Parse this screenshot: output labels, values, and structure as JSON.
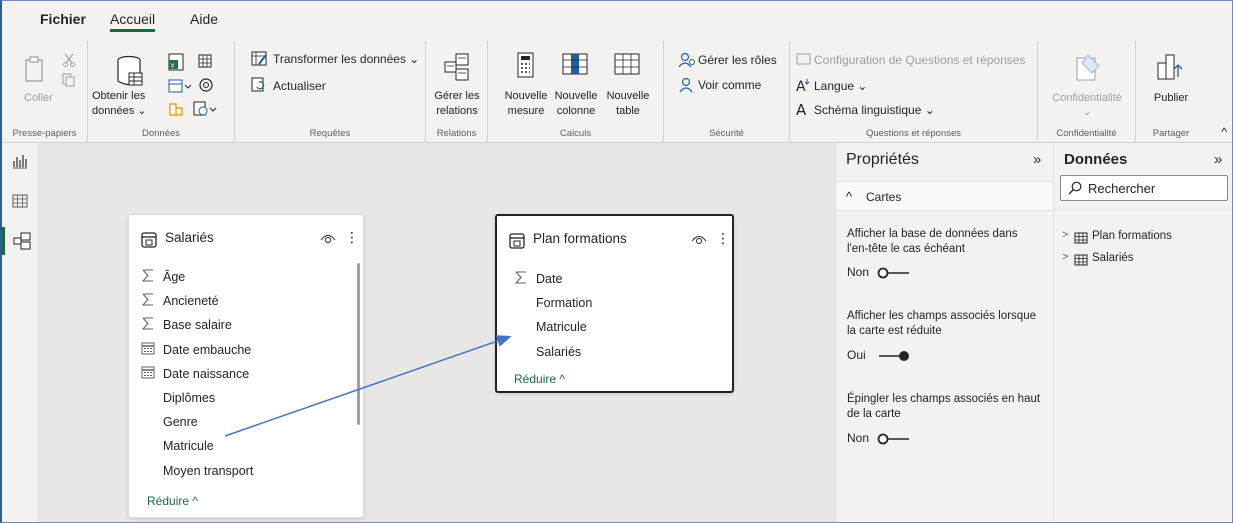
{
  "menu": {
    "tabs": [
      "Fichier",
      "Accueil",
      "Aide"
    ]
  },
  "ribbon": {
    "presse_papiers": {
      "label": "Presse-papiers",
      "coller": "Coller"
    },
    "donnees": {
      "label": "Données",
      "obtenir_line1": "Obtenir les",
      "obtenir_line2": "données ⌄"
    },
    "requetes": {
      "label": "Requêtes",
      "transformer": "Transformer les données ⌄",
      "actualiser": "Actualiser"
    },
    "relations": {
      "label": "Relations",
      "gerer_line1": "Gérer les",
      "gerer_line2": "relations"
    },
    "calculs": {
      "label": "Calculs",
      "mesure_line1": "Nouvelle",
      "mesure_line2": "mesure",
      "colonne_line1": "Nouvelle",
      "colonne_line2": "colonne",
      "table_line1": "Nouvelle",
      "table_line2": "table"
    },
    "securite": {
      "label": "Sécurité",
      "gerer_roles": "Gérer les rôles",
      "voir_comme": "Voir comme"
    },
    "questions": {
      "label": "Questions et réponses",
      "config": "Configuration de Questions et réponses",
      "langue": "Langue ⌄",
      "schema": "Schéma linguistique ⌄"
    },
    "confidentialite": {
      "label": "Confidentialité",
      "button": "Confidentialité",
      "caret": "⌄"
    },
    "partager": {
      "label": "Partager",
      "publier": "Publier"
    },
    "collapse": "^"
  },
  "tables": [
    {
      "title": "Salariés",
      "fields": [
        {
          "name": "Âge",
          "icon": "sigma"
        },
        {
          "name": "Ancieneté",
          "icon": "sigma"
        },
        {
          "name": "Base salaire",
          "icon": "sigma"
        },
        {
          "name": "Date embauche",
          "icon": "calendar"
        },
        {
          "name": "Date naissance",
          "icon": "calendar"
        },
        {
          "name": "Diplômes",
          "icon": ""
        },
        {
          "name": "Genre",
          "icon": ""
        },
        {
          "name": "Matricule",
          "icon": ""
        },
        {
          "name": "Moyen transport",
          "icon": ""
        }
      ],
      "reduce": "Réduire ^"
    },
    {
      "title": "Plan formations",
      "fields": [
        {
          "name": "Date",
          "icon": "sigma"
        },
        {
          "name": "Formation",
          "icon": ""
        },
        {
          "name": "Matricule",
          "icon": ""
        },
        {
          "name": "Salariés",
          "icon": ""
        }
      ],
      "reduce": "Réduire ^"
    }
  ],
  "properties": {
    "title": "Propriétés",
    "expand_icon": "»",
    "section": "Cartes",
    "section_caret": "^",
    "opt1_line1": "Afficher la base de données dans",
    "opt1_line2": "l'en-tête le cas échéant",
    "opt1_value": "Non",
    "opt2_line1": "Afficher les champs associés lorsque",
    "opt2_line2": "la carte est réduite",
    "opt2_value": "Oui",
    "opt3_line1": "Épingler les champs associés en haut",
    "opt3_line2": "de la carte",
    "opt3_value": "Non"
  },
  "data_pane": {
    "title": "Données",
    "expand_icon": "»",
    "search_placeholder": "Rechercher",
    "items": [
      "Plan formations",
      "Salariés"
    ]
  }
}
